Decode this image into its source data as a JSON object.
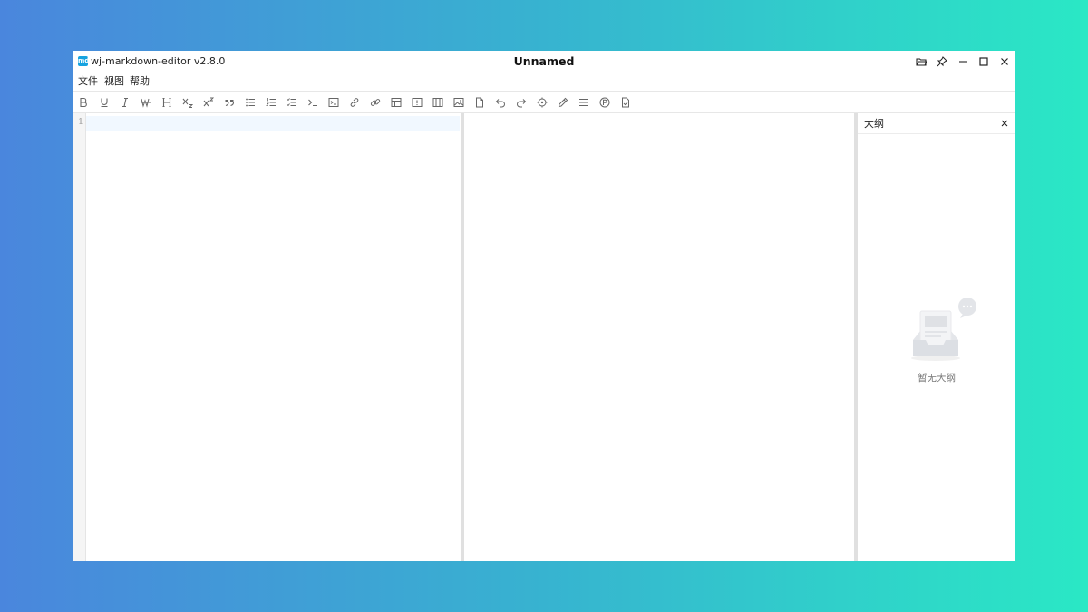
{
  "app": {
    "logo_text": "md",
    "name": "wj-markdown-editor v2.8.0",
    "document_title": "Unnamed"
  },
  "window_controls": [
    {
      "name": "open-folder-icon"
    },
    {
      "name": "pin-icon"
    },
    {
      "name": "minimize-icon"
    },
    {
      "name": "maximize-icon"
    },
    {
      "name": "close-icon"
    }
  ],
  "menu": {
    "items": [
      "文件",
      "视图",
      "帮助"
    ]
  },
  "toolbar": {
    "icons": [
      "bold-icon",
      "underline-icon",
      "italic-icon",
      "strikethrough-icon",
      "heading-icon",
      "subscript-icon",
      "superscript-icon",
      "quote-icon",
      "bullet-list-icon",
      "ordered-list-icon",
      "task-list-icon",
      "inline-code-icon",
      "code-block-icon",
      "link-icon",
      "link-alt-icon",
      "table-icon",
      "alert-icon",
      "container-icon",
      "image-icon",
      "file-icon",
      "undo-icon",
      "redo-icon",
      "locate-icon",
      "pen-icon",
      "menu-lines-icon",
      "circle-p-icon",
      "doc-check-icon"
    ]
  },
  "editor": {
    "line_numbers": [
      "1"
    ]
  },
  "outline": {
    "title": "大纲",
    "empty_text": "暂无大纲"
  }
}
